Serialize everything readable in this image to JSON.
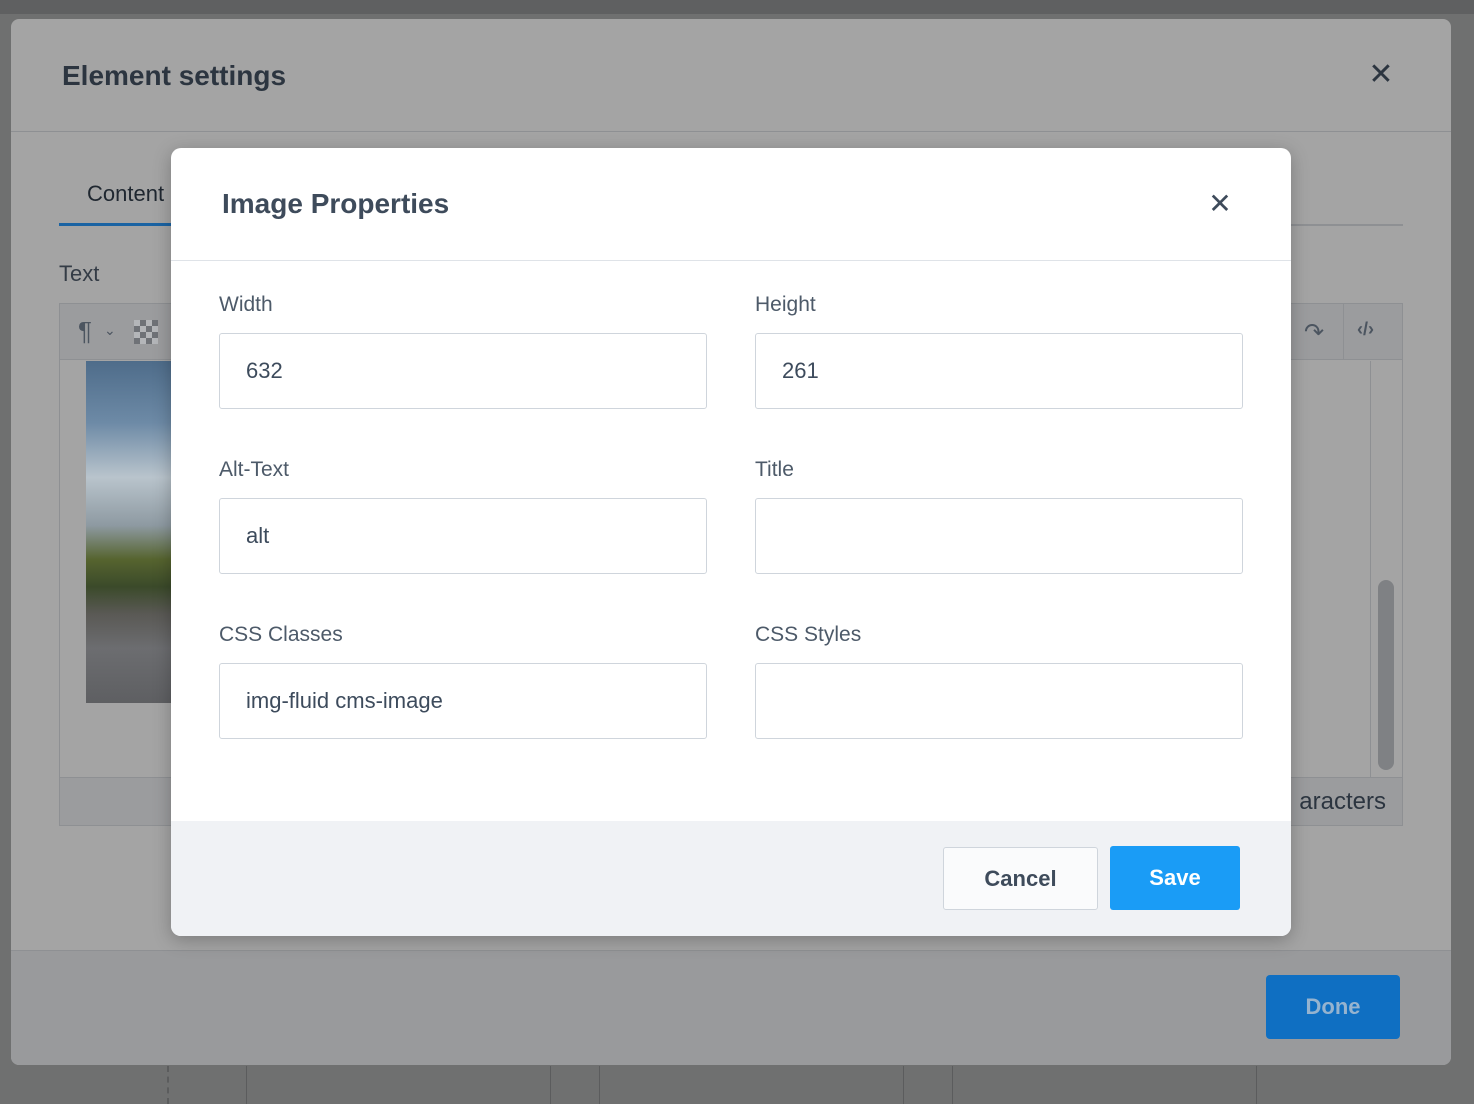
{
  "element_settings": {
    "title": "Element settings",
    "tabs": [
      {
        "label": "Content"
      }
    ],
    "text_label": "Text",
    "status_text_fragment": "aracters",
    "done_label": "Done",
    "icons": {
      "close": "close-icon",
      "paragraph": "paragraph-icon",
      "chevron": "chevron-down-icon",
      "checker": "transparency-icon",
      "redo": "redo-icon",
      "code": "code-view-icon"
    }
  },
  "image_properties": {
    "title": "Image Properties",
    "fields": {
      "width": {
        "label": "Width",
        "value": "632"
      },
      "height": {
        "label": "Height",
        "value": "261"
      },
      "alt_text": {
        "label": "Alt-Text",
        "value": "alt"
      },
      "title": {
        "label": "Title",
        "value": ""
      },
      "css_classes": {
        "label": "CSS Classes",
        "value": "img-fluid cms-image"
      },
      "css_styles": {
        "label": "CSS Styles",
        "value": ""
      }
    },
    "cancel_label": "Cancel",
    "save_label": "Save"
  },
  "colors": {
    "primary_button": "#1a9cf6",
    "done_button": "#0f6fc2",
    "title_text": "#3e4b5b"
  }
}
